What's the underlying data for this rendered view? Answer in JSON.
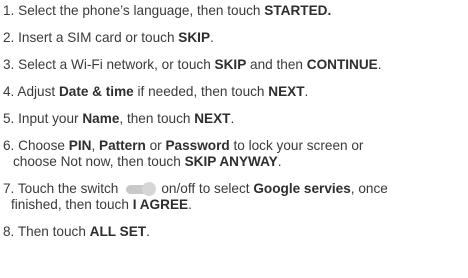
{
  "steps": [
    {
      "num": "1.",
      "t1": "Select the phone’s language, then touch ",
      "b1": "STARTED."
    },
    {
      "num": "2.",
      "t1": "Insert a SIM card or touch ",
      "b1": "SKIP",
      "t2": "."
    },
    {
      "num": "3.",
      "t1": "Select a Wi-Fi network, or touch ",
      "b1": "SKIP",
      "t2": " and then ",
      "b2": "CONTINUE",
      "t3": "."
    },
    {
      "num": "4.",
      "t1": "Adjust ",
      "b1": "Date & time",
      "t2": " if needed, then touch ",
      "b2": "NEXT",
      "t3": "."
    },
    {
      "num": "5.",
      "t1": "Input your ",
      "b1": "Name",
      "t2": ", then touch ",
      "b2": "NEXT",
      "t3": "."
    },
    {
      "num": "6.",
      "t1": "Choose ",
      "b1": "PIN",
      "t2": ", ",
      "b2": "Pattern",
      "t3": " or ",
      "b3": "Password",
      "t4": " to lock your screen or",
      "l2a": "choose Not now, then touch ",
      "l2b": "SKIP ANYWAY",
      "l2c": "."
    },
    {
      "num": "7.",
      "t1": "Touch the switch",
      "t2": "on/off to select ",
      "b1": "Google servies",
      "t3": ", once",
      "l2a": "finished, then touch ",
      "l2b": "I AGREE",
      "l2c": "."
    },
    {
      "num": "8.",
      "t1": "Then touch ",
      "b1": "ALL SET",
      "t2": "."
    }
  ]
}
